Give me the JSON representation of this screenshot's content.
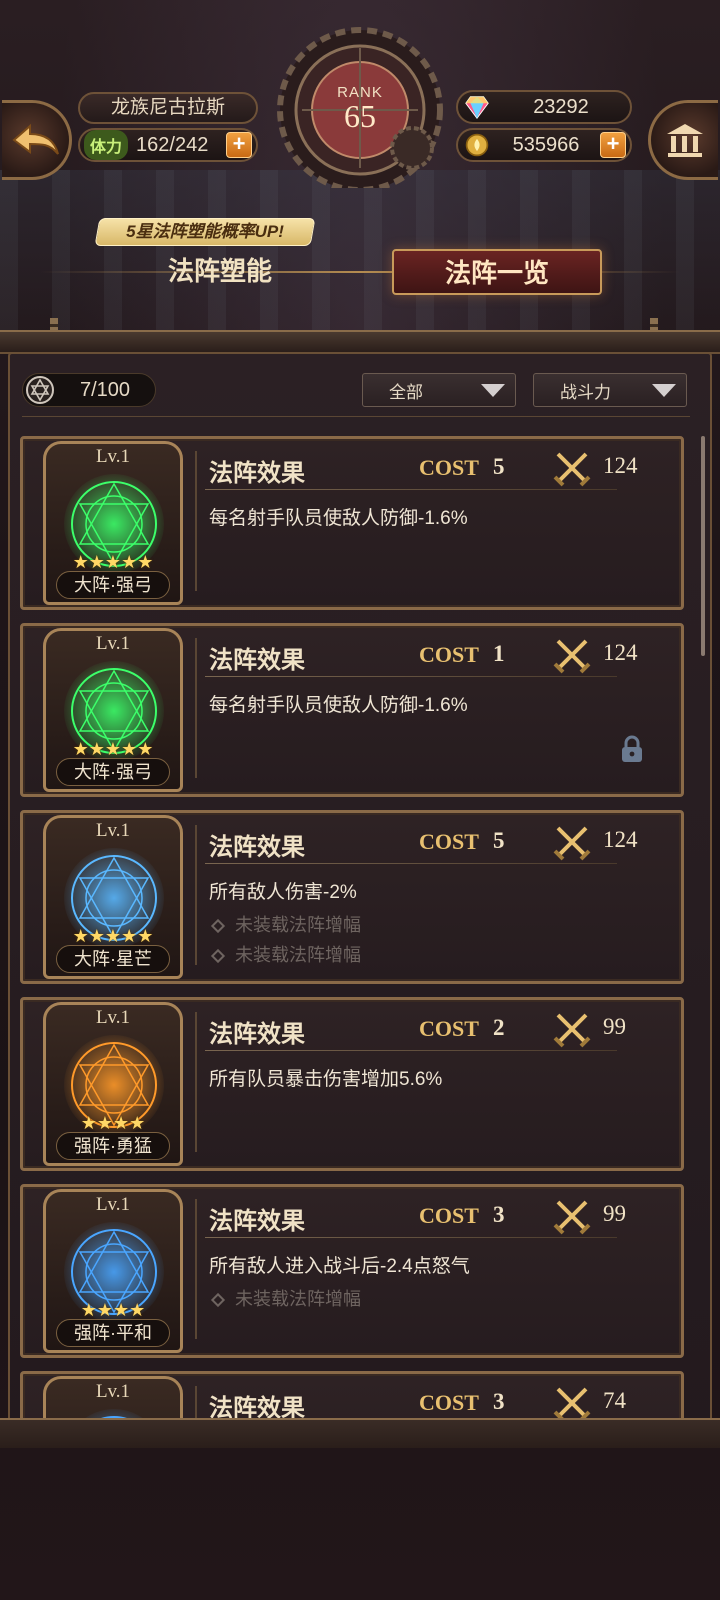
{
  "hud": {
    "player_name": "龙族尼古拉斯",
    "stamina_label": "体力",
    "stamina_value": "162/242",
    "rank_label": "RANK",
    "rank_value": "65",
    "gems": "23292",
    "gold": "535966",
    "plus": "+"
  },
  "promo": "5星法阵塑能概率UP!",
  "tabs": [
    {
      "label": "法阵塑能",
      "active": false
    },
    {
      "label": "法阵一览",
      "active": true
    }
  ],
  "toolbar": {
    "count": "7/100",
    "filter_all": "全部",
    "sort_power": "战斗力"
  },
  "cards": [
    {
      "level": "Lv.1",
      "name": "大阵·强弓",
      "stars": "★★★★★",
      "effect_title": "法阵效果",
      "cost_label": "COST",
      "cost": "5",
      "power": "124",
      "desc": "每名射手队员使敌人防御-1.6%",
      "subs": [],
      "locked": false,
      "color": "#3cff6a"
    },
    {
      "level": "Lv.1",
      "name": "大阵·强弓",
      "stars": "★★★★★",
      "effect_title": "法阵效果",
      "cost_label": "COST",
      "cost": "1",
      "power": "124",
      "desc": "每名射手队员使敌人防御-1.6%",
      "subs": [],
      "locked": true,
      "color": "#3cff6a"
    },
    {
      "level": "Lv.1",
      "name": "大阵·星芒",
      "stars": "★★★★★",
      "effect_title": "法阵效果",
      "cost_label": "COST",
      "cost": "5",
      "power": "124",
      "desc": "所有敌人伤害-2%",
      "subs": [
        "未装载法阵增幅",
        "未装载法阵增幅"
      ],
      "locked": false,
      "color": "#5ab8ff"
    },
    {
      "level": "Lv.1",
      "name": "强阵·勇猛",
      "stars": "★★★★",
      "effect_title": "法阵效果",
      "cost_label": "COST",
      "cost": "2",
      "power": "99",
      "desc": "所有队员暴击伤害增加5.6%",
      "subs": [],
      "locked": false,
      "color": "#ff9a2a"
    },
    {
      "level": "Lv.1",
      "name": "强阵·平和",
      "stars": "★★★★",
      "effect_title": "法阵效果",
      "cost_label": "COST",
      "cost": "3",
      "power": "99",
      "desc": "所有敌人进入战斗后-2.4点怒气",
      "subs": [
        "未装载法阵增幅"
      ],
      "locked": false,
      "color": "#4aa6ff"
    },
    {
      "level": "Lv.1",
      "name": "",
      "stars": "",
      "effect_title": "法阵效果",
      "cost_label": "COST",
      "cost": "3",
      "power": "74",
      "desc": "",
      "subs": [],
      "locked": false,
      "color": "#4aa6ff"
    }
  ]
}
